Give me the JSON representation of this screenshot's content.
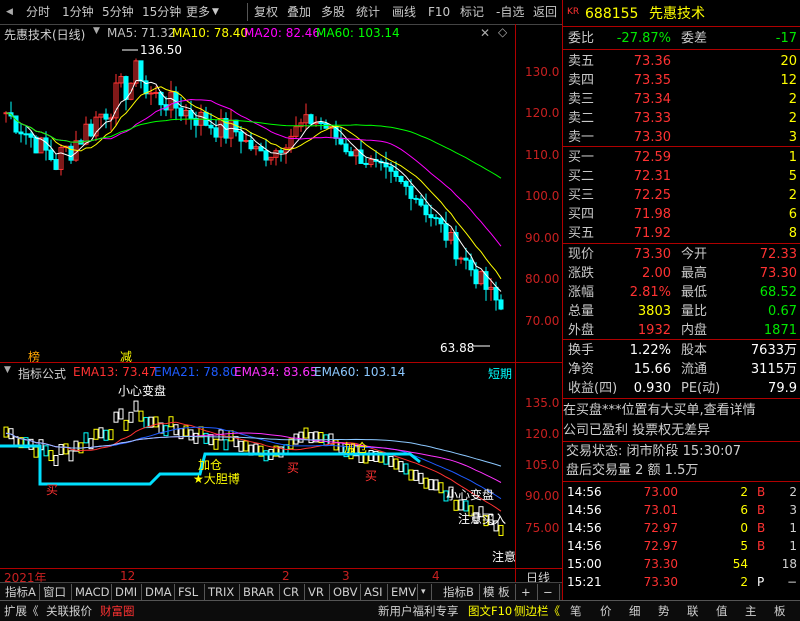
{
  "toolbar": {
    "left_items": [
      "分时",
      "1分钟",
      "5分钟",
      "15分钟",
      "更多"
    ],
    "right_items": [
      "复权",
      "叠加",
      "多股",
      "统计",
      "画线",
      "F10",
      "标记",
      "-自选",
      "返回"
    ]
  },
  "main_chart": {
    "title": "先惠技术(日线)",
    "ma": [
      {
        "label": "MA5: 71.32",
        "color": "#ffffff"
      },
      {
        "label": "MA10: 78.40",
        "color": "#ffff00"
      },
      {
        "label": "MA20: 82.46",
        "color": "#ff00ff"
      },
      {
        "label": "MA60: 103.14",
        "color": "#00ff00"
      }
    ],
    "high_label": "136.50",
    "low_label": "63.88",
    "y_ticks": [
      "130.0",
      "120.0",
      "110.0",
      "100.0",
      "90.00",
      "80.00",
      "70.00"
    ],
    "badge_left": "榜",
    "badge_right": "减"
  },
  "sub_chart": {
    "title": "指标公式",
    "ema": [
      {
        "label": "EMA13: 73.47",
        "color": "#ff3232"
      },
      {
        "label": "EMA21: 78.80",
        "color": "#1e5bff"
      },
      {
        "label": "EMA34: 83.65",
        "color": "#ff32ff"
      },
      {
        "label": "EMA60: 103.14",
        "color": "#8cc8ff"
      }
    ],
    "period_label": "短期",
    "y_ticks": [
      "135.0",
      "120.0",
      "105.0",
      "90.00",
      "75.00"
    ],
    "annotations": {
      "caution": "小心变盘",
      "bold_buy": "★大胆博",
      "add": "加仓",
      "buy": "买",
      "caution2": "小心变盘",
      "note_buy": "注意买入",
      "note": "注意"
    }
  },
  "date_row": {
    "labels": [
      "2021年",
      "12",
      "2",
      "3",
      "4"
    ],
    "right": "日线"
  },
  "bottom_tabs": [
    "指标A",
    "窗口",
    "MACD",
    "DMI",
    "DMA",
    "FSL",
    "TRIX",
    "BRAR",
    "CR",
    "VR",
    "OBV",
    "ASI",
    "EMV",
    "▾",
    "指标B",
    "模 板",
    "+",
    "−"
  ],
  "status_bar": {
    "left": [
      "扩展《",
      "关联报价",
      "财富圈"
    ],
    "center": [
      "新用户福利专享",
      "图文F10",
      "侧边栏《"
    ],
    "right": [
      "笔",
      "价",
      "细",
      "势",
      "联",
      "值",
      "主",
      "板"
    ]
  },
  "quote": {
    "badge": "KR",
    "code": "688155",
    "name": "先惠技术",
    "weibi_label": "委比",
    "weibi": "-27.87%",
    "weicha_label": "委差",
    "weicha": "-17",
    "asks": [
      {
        "label": "卖五",
        "price": "73.36",
        "vol": "20"
      },
      {
        "label": "卖四",
        "price": "73.35",
        "vol": "12"
      },
      {
        "label": "卖三",
        "price": "73.34",
        "vol": "2"
      },
      {
        "label": "卖二",
        "price": "73.33",
        "vol": "2"
      },
      {
        "label": "卖一",
        "price": "73.30",
        "vol": "3"
      }
    ],
    "bids": [
      {
        "label": "买一",
        "price": "72.59",
        "vol": "1"
      },
      {
        "label": "买二",
        "price": "72.31",
        "vol": "5"
      },
      {
        "label": "买三",
        "price": "72.25",
        "vol": "2"
      },
      {
        "label": "买四",
        "price": "71.98",
        "vol": "6"
      },
      {
        "label": "买五",
        "price": "71.92",
        "vol": "8"
      }
    ],
    "stats": [
      {
        "l1": "现价",
        "v1": "73.30",
        "c1": "red",
        "l2": "今开",
        "v2": "72.33",
        "c2": "red"
      },
      {
        "l1": "涨跌",
        "v1": "2.00",
        "c1": "red",
        "l2": "最高",
        "v2": "73.30",
        "c2": "red"
      },
      {
        "l1": "涨幅",
        "v1": "2.81%",
        "c1": "red",
        "l2": "最低",
        "v2": "68.52",
        "c2": "green"
      },
      {
        "l1": "总量",
        "v1": "3803",
        "c1": "yellow",
        "l2": "量比",
        "v2": "0.67",
        "c2": "green"
      },
      {
        "l1": "外盘",
        "v1": "1932",
        "c1": "red",
        "l2": "内盘",
        "v2": "1871",
        "c2": "green"
      }
    ],
    "stats2": [
      {
        "l1": "换手",
        "v1": "1.22%",
        "l2": "股本",
        "v2": "7633万"
      },
      {
        "l1": "净资",
        "v1": "15.66",
        "l2": "流通",
        "v2": "3115万"
      },
      {
        "l1": "收益(四)",
        "v1": "0.930",
        "l2": "PE(动)",
        "v2": "79.9"
      }
    ],
    "news1": "在买盘***位置有大买单,查看详情",
    "news2": "公司已盈利 投票权无差异",
    "trade_state": "交易状态: 闭市阶段 15:30:07",
    "after_hours": "盘后交易量 2 额 1.5万",
    "ticks": [
      {
        "t": "14:56",
        "p": "73.00",
        "pc": "red",
        "v": "2",
        "d": "B",
        "dc": "red",
        "n": "2"
      },
      {
        "t": "14:56",
        "p": "73.01",
        "pc": "red",
        "v": "6",
        "d": "B",
        "dc": "red",
        "n": "3"
      },
      {
        "t": "14:56",
        "p": "72.97",
        "pc": "red",
        "v": "0",
        "d": "B",
        "dc": "red",
        "n": "1"
      },
      {
        "t": "14:56",
        "p": "72.97",
        "pc": "red",
        "v": "5",
        "d": "B",
        "dc": "red",
        "n": "1"
      },
      {
        "t": "15:00",
        "p": "73.30",
        "pc": "red",
        "v": "54",
        "d": "",
        "dc": "red",
        "n": "18"
      },
      {
        "t": "15:21",
        "p": "73.30",
        "pc": "red",
        "v": "2",
        "d": "P",
        "dc": "white",
        "n": "−"
      }
    ]
  },
  "colors": {
    "up": "#ff3232",
    "down": "#00ffff",
    "axis": "#b00000",
    "bg": "#000000"
  }
}
